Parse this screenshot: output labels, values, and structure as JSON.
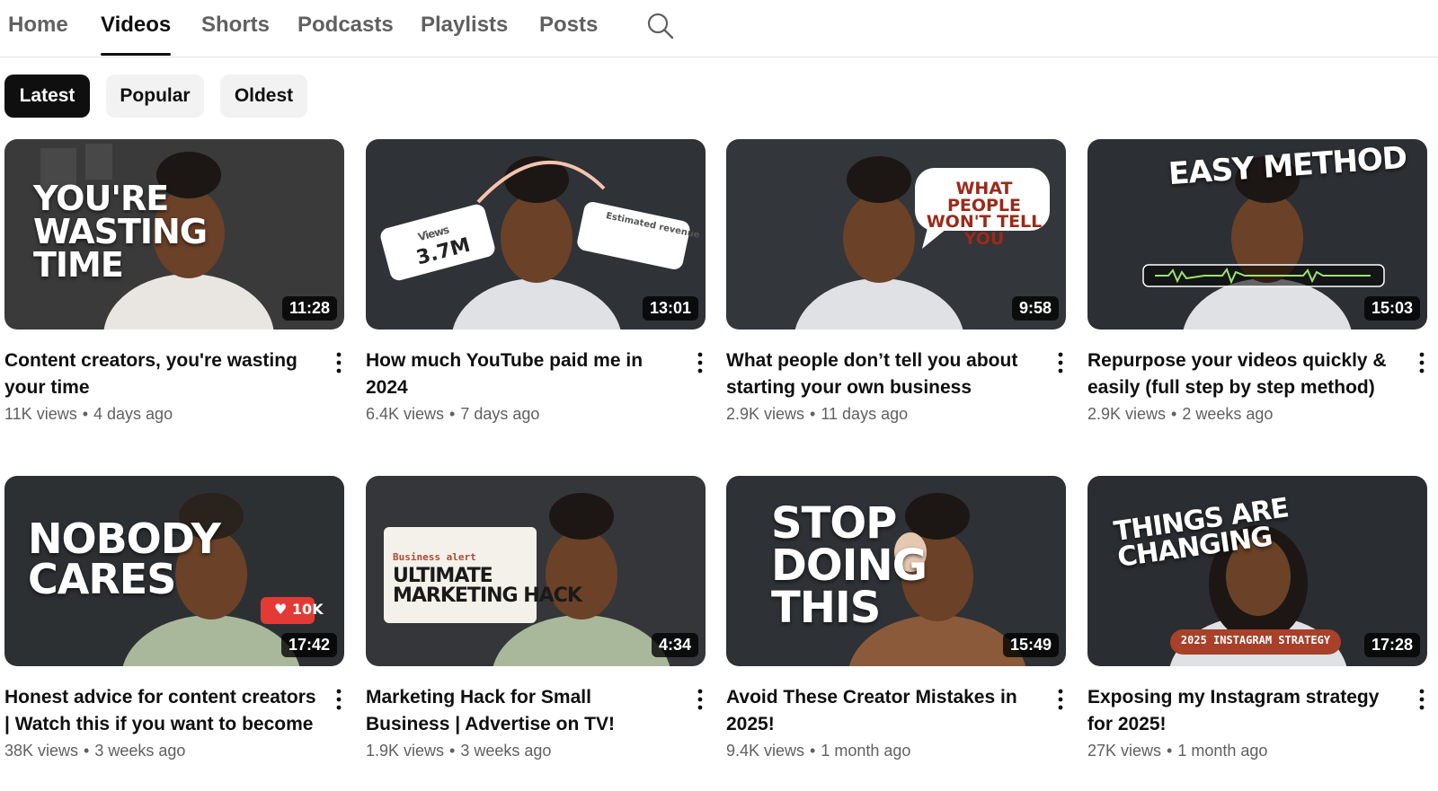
{
  "tabs": [
    {
      "label": "Home",
      "active": false
    },
    {
      "label": "Videos",
      "active": true
    },
    {
      "label": "Shorts",
      "active": false
    },
    {
      "label": "Podcasts",
      "active": false
    },
    {
      "label": "Playlists",
      "active": false
    },
    {
      "label": "Posts",
      "active": false
    }
  ],
  "chips": [
    {
      "label": "Latest",
      "active": true
    },
    {
      "label": "Popular",
      "active": false
    },
    {
      "label": "Oldest",
      "active": false
    }
  ],
  "videos": [
    {
      "title": "Content creators, you're wasting your time",
      "views": "11K views",
      "age": "4 days ago",
      "duration": "11:28",
      "thumb_text": [
        "YOU'RE",
        "WASTING",
        "TIME"
      ],
      "thumb_color": "#3a3a3a"
    },
    {
      "title": "How much YouTube paid me in 2024",
      "views": "6.4K views",
      "age": "7 days ago",
      "duration": "13:01",
      "thumb_card_label": "Views",
      "thumb_card_value": "3.7M",
      "thumb_card2_label": "Estimated revenue",
      "thumb_color": "#2f3236"
    },
    {
      "title": "What people don’t tell you about starting your own business",
      "views": "2.9K views",
      "age": "11 days ago",
      "duration": "9:58",
      "thumb_text": [
        "WHAT PEOPLE",
        "WON'T TELL YOU"
      ],
      "thumb_color": "#33363a"
    },
    {
      "title": "Repurpose your videos quickly & easily (full step by step method)",
      "views": "2.9K views",
      "age": "2 weeks ago",
      "duration": "15:03",
      "thumb_text": [
        "EASY METHOD"
      ],
      "thumb_color": "#2c2f33"
    },
    {
      "title": "Honest advice for content creators | Watch this if you want to become …",
      "views": "38K views",
      "age": "3 weeks ago",
      "duration": "17:42",
      "thumb_text": [
        "NOBODY",
        "CARES"
      ],
      "thumb_badge": "10K",
      "thumb_color": "#2d3033"
    },
    {
      "title": "Marketing Hack for Small Business | Advertise on TV!",
      "views": "1.9K views",
      "age": "3 weeks ago",
      "duration": "4:34",
      "thumb_card_label": "Business alert",
      "thumb_text": [
        "ULTIMATE",
        "MARKETING HACK"
      ],
      "thumb_color": "#34363a"
    },
    {
      "title": "Avoid These Creator Mistakes in 2025!",
      "views": "9.4K views",
      "age": "1 month ago",
      "duration": "15:49",
      "thumb_text": [
        "STOP",
        "DOING",
        "THIS"
      ],
      "thumb_color": "#2e3135"
    },
    {
      "title": "Exposing my Instagram strategy for 2025!",
      "views": "27K views",
      "age": "1 month ago",
      "duration": "17:28",
      "thumb_text": [
        "THINGS ARE CHANGING"
      ],
      "thumb_badge": "2025 INSTAGRAM STRATEGY",
      "thumb_color": "#2a2d31"
    }
  ],
  "icons": {
    "search": "search-icon",
    "menu": "more-vert-icon"
  },
  "colors": {
    "active_chip": "#0f0f0f",
    "chip_bg": "#f2f2f2",
    "meta_text": "#606060",
    "badge_red": "#e53935"
  }
}
